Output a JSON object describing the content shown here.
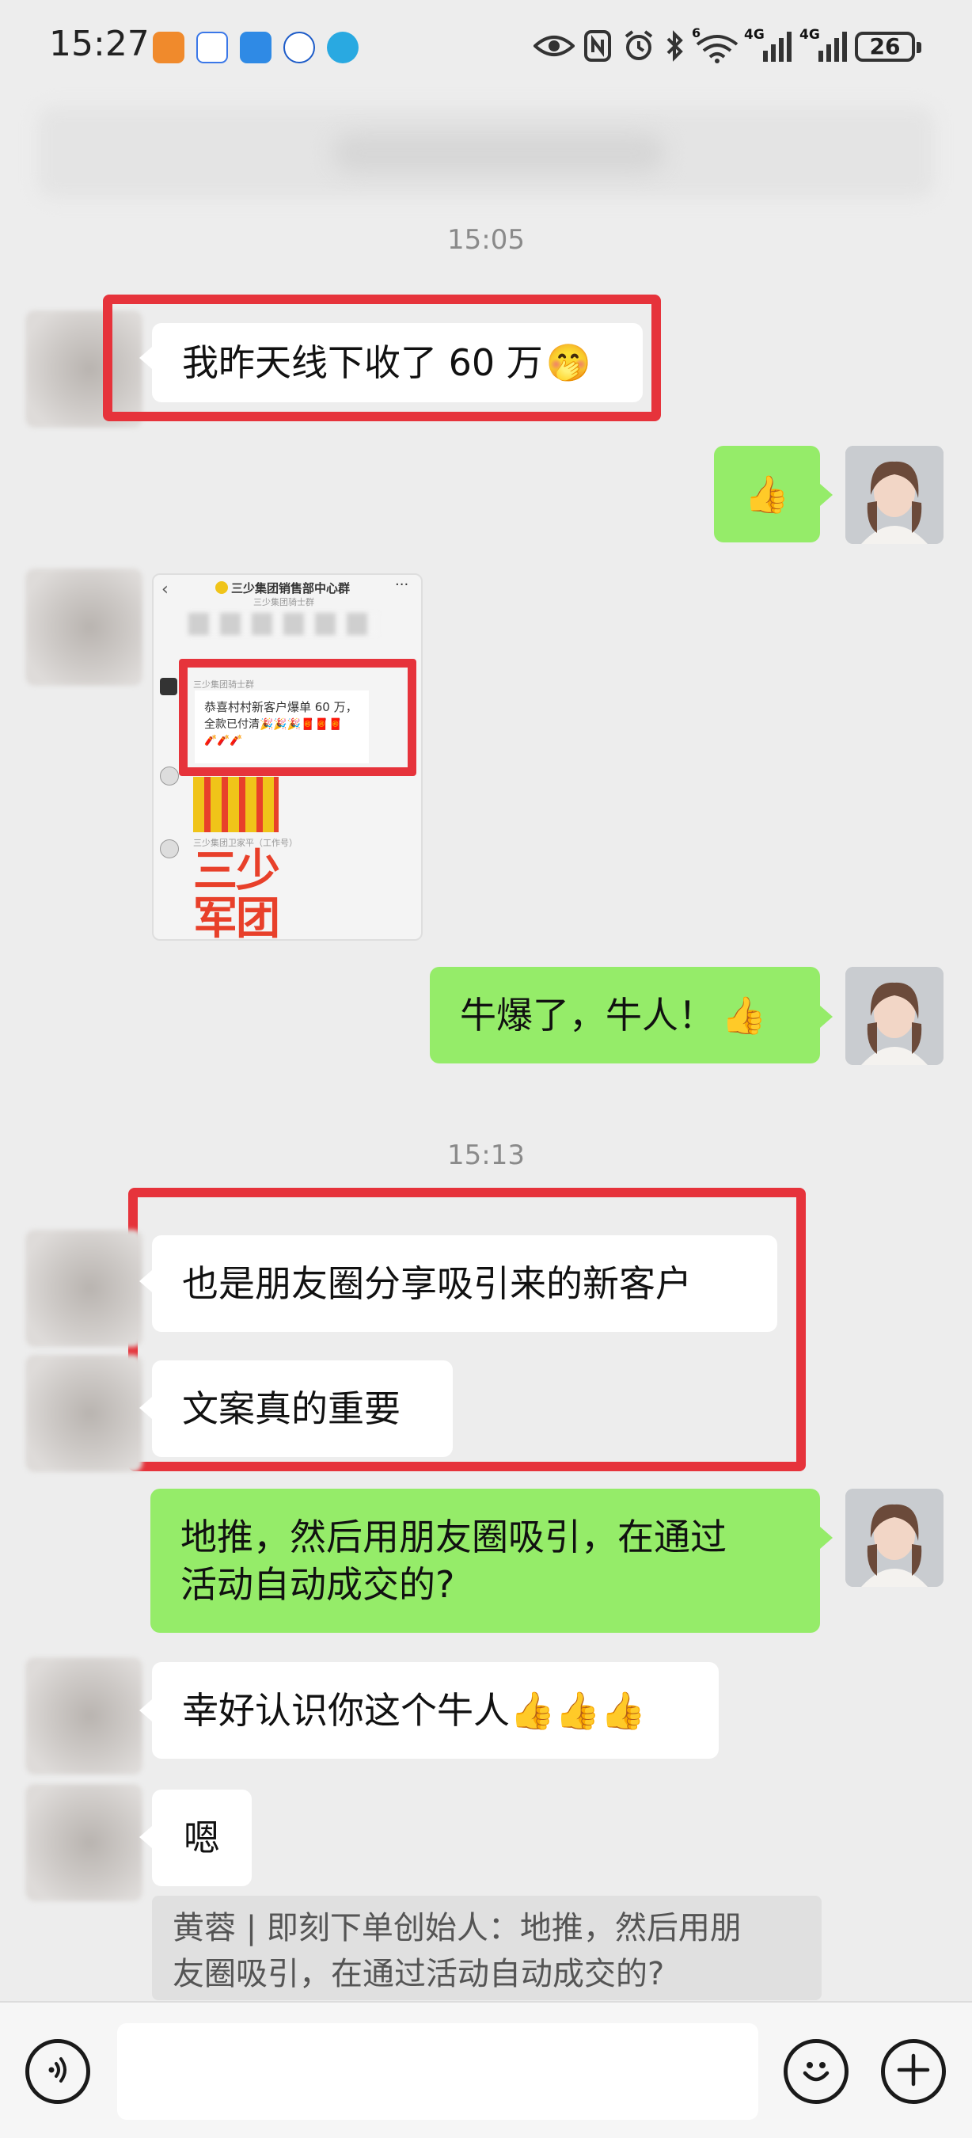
{
  "status_bar": {
    "time": "15:27",
    "battery": "26",
    "signal_label_1": "4G",
    "signal_label_2": "4G",
    "wifi_label": "6"
  },
  "colors": {
    "out_bubble": "#95ec69",
    "in_bubble": "#ffffff",
    "highlight": "#e6333b",
    "background": "#ededed"
  },
  "timestamps": [
    "15:05",
    "15:13"
  ],
  "messages": {
    "m1": "我昨天线下收了 60 万",
    "m1_emoji": "🤭",
    "m2_emoji": "👍",
    "m4": "牛爆了，牛人！",
    "m4_emoji": "👍",
    "m5": "也是朋友圈分享吸引来的新客户",
    "m6": "文案真的重要",
    "m7_line1": "地推，然后用朋友圈吸引，在通过",
    "m7_line2": "活动自动成交的?",
    "m8": "幸好认识你这个牛人",
    "m8_emojis": "👍👍👍",
    "m9": "嗯"
  },
  "quote": {
    "line1": "黄蓉 | 即刻下单创始人：地推，然后用朋",
    "line2": "友圈吸引，在通过活动自动成交的?"
  },
  "shot": {
    "title": "三少集团销售部中心群",
    "subtitle": "三少集团骑士群",
    "sender1": "三少集团骑士群",
    "card_line1": "恭喜村村新客户爆单 60 万，",
    "card_line2": "全款已付清🎉🎉🎉🧧🧧🧧",
    "card_line3": "🧨🧨🧨",
    "sender2": "三少集团卫家平（工作号）",
    "big_text_1": "三少",
    "big_text_2": "军团"
  },
  "input": {
    "placeholder": ""
  },
  "icons": {
    "voice": "voice-icon",
    "emoji": "emoji-icon",
    "plus": "plus-icon"
  }
}
